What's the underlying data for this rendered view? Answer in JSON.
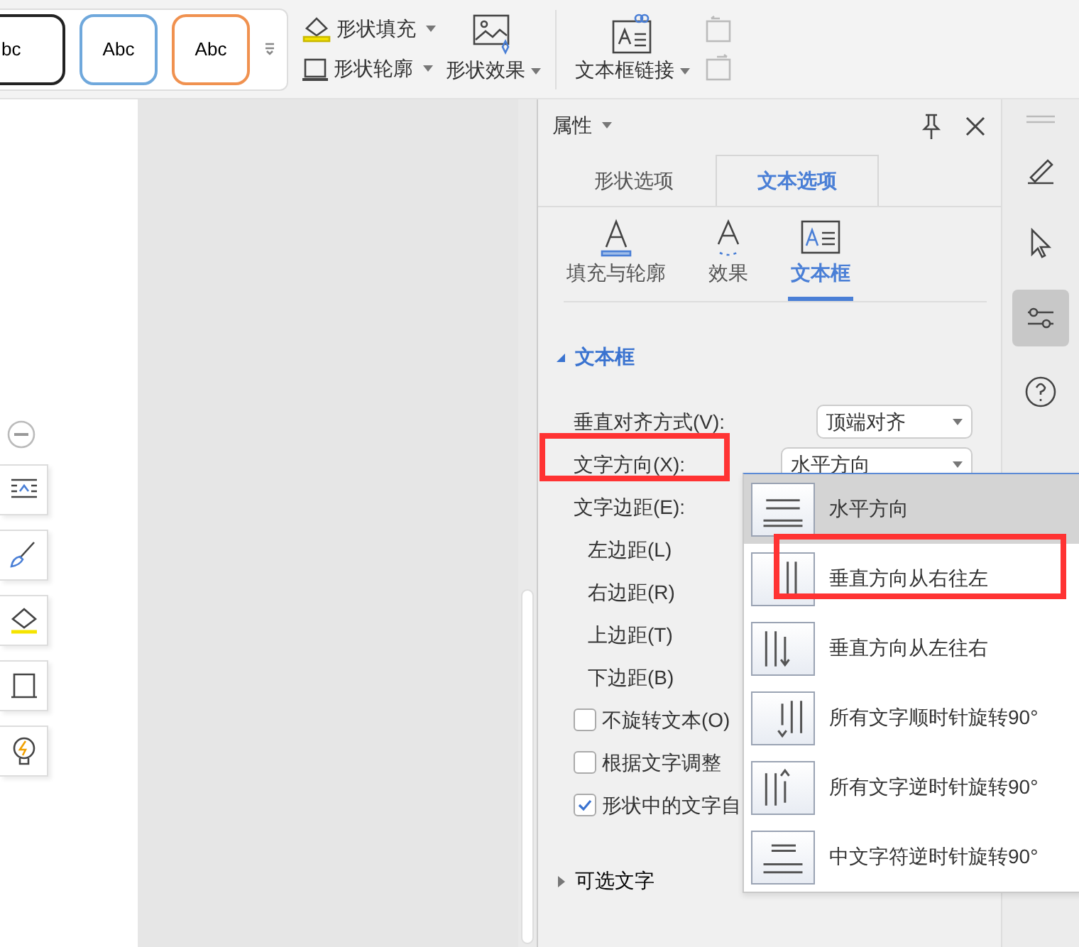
{
  "ribbon": {
    "gallery": [
      {
        "label": "bc",
        "color": "#222222"
      },
      {
        "label": "Abc",
        "color": "#6fa8dc"
      },
      {
        "label": "Abc",
        "color": "#f0914f"
      }
    ],
    "small_buttons": [
      {
        "label": "形状填充",
        "kind": "fill"
      },
      {
        "label": "形状轮廓",
        "kind": "outline"
      }
    ],
    "large_buttons": [
      {
        "label": "形状效果",
        "kind": "effect"
      },
      {
        "label": "文本框链接",
        "kind": "link"
      }
    ]
  },
  "panel": {
    "title": "属性",
    "tabs": [
      {
        "label": "形状选项",
        "selected": false
      },
      {
        "label": "文本选项",
        "selected": true
      }
    ],
    "subtabs": [
      {
        "label": "填充与轮廓",
        "kind": "fill",
        "selected": false
      },
      {
        "label": "效果",
        "kind": "effect",
        "selected": false
      },
      {
        "label": "文本框",
        "kind": "textbox",
        "selected": true
      }
    ],
    "section": {
      "title": "文本框",
      "expanded": true
    },
    "fields": [
      {
        "label": "垂直对齐方式(V):",
        "value": "顶端对齐"
      },
      {
        "label": "文字方向(X):",
        "value": "水平方向"
      },
      {
        "label": "文字边距(E):"
      }
    ],
    "margins": [
      "左边距(L)",
      "右边距(R)",
      "上边距(T)",
      "下边距(B)"
    ],
    "checkboxes": [
      {
        "label": "不旋转文本(O)",
        "checked": false
      },
      {
        "label": "根据文字调整",
        "checked": false
      },
      {
        "label": "形状中的文字自",
        "checked": true
      }
    ],
    "section_2": {
      "title": "可选文字",
      "expanded": false
    }
  },
  "dropdown": {
    "items": [
      {
        "label": "水平方向",
        "kind": "horizontal",
        "selected": true
      },
      {
        "label": "垂直方向从右往左",
        "kind": "vertical-rtl",
        "selected": false
      },
      {
        "label": "垂直方向从左往右",
        "kind": "vertical-ltr",
        "selected": false
      },
      {
        "label": "所有文字顺时针旋转90°",
        "kind": "rotate-cw",
        "selected": false
      },
      {
        "label": "所有文字逆时针旋转90°",
        "kind": "rotate-ccw",
        "selected": false
      },
      {
        "label": "中文字符逆时针旋转90°",
        "kind": "cjk-rotate",
        "selected": false
      }
    ]
  }
}
